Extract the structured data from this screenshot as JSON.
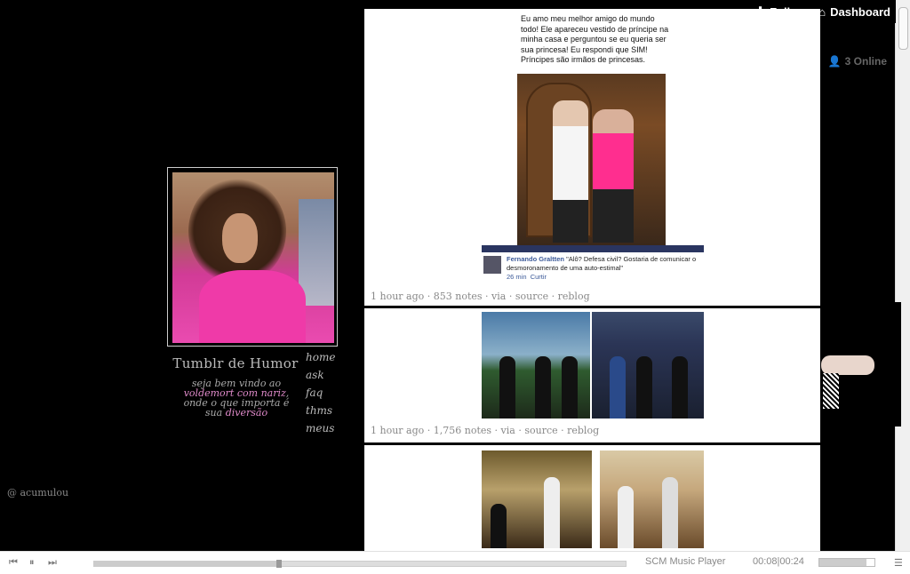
{
  "topbar": {
    "follow_label": "Follow",
    "dashboard_label": "Dashboard",
    "online_label": "3 Online"
  },
  "blog": {
    "title": "Tumblr de Humor",
    "desc_line1": "seja bem vindo ao",
    "desc_pink1": "voldemort com nariz",
    "desc_line2": ", onde o que importa é sua",
    "desc_pink2": "diversão",
    "credit": "@ acumulou"
  },
  "nav": [
    "home",
    "ask",
    "faq",
    "thms",
    "meus"
  ],
  "posts": [
    {
      "caption": "Eu amo meu melhor amigo do mundo todo! Ele apareceu vestido de príncipe na minha casa e perguntou se eu queria ser sua princesa! Eu respondi que SIM! Príncipes são irmãos de princesas.",
      "fb_name": "Fernando Graltten",
      "fb_text": "\"Alô? Defesa civil? Gostaria de comunicar o desmoronamento de uma auto-estimal\"",
      "fb_time": "26 min",
      "fb_action": "Curtir",
      "time": "1 hour ago",
      "notes": "853 notes",
      "via": "via",
      "source": "source",
      "reblog": "reblog"
    },
    {
      "time": "1 hour ago",
      "notes": "1,756 notes",
      "via": "via",
      "source": "source",
      "reblog": "reblog"
    }
  ],
  "player": {
    "name": "SCM Music Player",
    "time": "00:08|00:24",
    "progress": 0.35,
    "volume": 0.85
  }
}
